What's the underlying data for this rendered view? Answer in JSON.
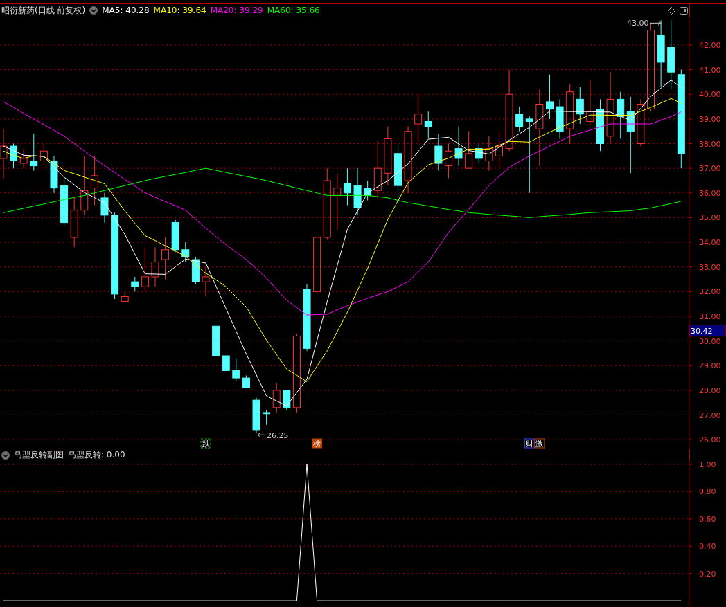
{
  "header": {
    "title": "昭衍新药(日线 前复权)",
    "ma": [
      {
        "label": "MA5: 40.28",
        "color": "#ffffff"
      },
      {
        "label": "MA10: 39.64",
        "color": "#ffff00"
      },
      {
        "label": "MA20: 39.29",
        "color": "#ff00ff"
      },
      {
        "label": "MA60: 35.66",
        "color": "#00ff00"
      }
    ]
  },
  "price_chart": {
    "chart_data": {
      "type": "candlestick",
      "grid": true,
      "ylim": [
        25.64,
        43.15
      ],
      "ohlc": [
        [
          37.4,
          38.6,
          36.6,
          37.9
        ],
        [
          37.9,
          38,
          37,
          37.3
        ],
        [
          37.2,
          37.8,
          37,
          37.4
        ],
        [
          37.3,
          38.4,
          36.9,
          37.1
        ],
        [
          37.3,
          38,
          37.1,
          37.7
        ],
        [
          37.3,
          37.5,
          36,
          36.2
        ],
        [
          36.3,
          36.6,
          34.7,
          34.8
        ],
        [
          34.2,
          35.8,
          33.8,
          35.3
        ],
        [
          35.3,
          37.5,
          35.1,
          36.1
        ],
        [
          36.2,
          37.5,
          35.5,
          36.7
        ],
        [
          35.8,
          36,
          34.8,
          35.1
        ],
        [
          35.1,
          35.2,
          31.7,
          31.9
        ],
        [
          31.6,
          32,
          31.6,
          31.8
        ],
        [
          32.4,
          32.6,
          32,
          32.2
        ],
        [
          32.2,
          33.8,
          32,
          32.6
        ],
        [
          32.6,
          33.8,
          32.2,
          33.2
        ],
        [
          33.3,
          34.2,
          32.5,
          33.7
        ],
        [
          34.8,
          34.9,
          33.6,
          33.7
        ],
        [
          33.7,
          34,
          33.2,
          33.4
        ],
        [
          33.3,
          33.4,
          32.3,
          32.4
        ],
        [
          32.4,
          33,
          31.8,
          32.6
        ],
        [
          30.6,
          30.6,
          29.4,
          29.4
        ],
        [
          29.4,
          29.4,
          28.8,
          28.8
        ],
        [
          28.8,
          29.3,
          28.4,
          28.5
        ],
        [
          28.5,
          28.6,
          28.1,
          28.1
        ],
        [
          27.6,
          27.7,
          26.25,
          26.4
        ],
        [
          27.1,
          27.2,
          26.6,
          27.05
        ],
        [
          27.3,
          28.3,
          27.1,
          28
        ],
        [
          28,
          28,
          27.2,
          27.3
        ],
        [
          27.3,
          30.3,
          27.1,
          30.2
        ],
        [
          32.1,
          32.3,
          29.6,
          29.7
        ],
        [
          32,
          34.2,
          31.9,
          34.2
        ],
        [
          34.2,
          37,
          34.1,
          36.5
        ],
        [
          35.9,
          36.8,
          34.5,
          36.2
        ],
        [
          36.4,
          37,
          35.5,
          36
        ],
        [
          36.3,
          37,
          35.1,
          35.4
        ],
        [
          36.2,
          36.5,
          35.7,
          35.9
        ],
        [
          36.1,
          38.1,
          35.8,
          37
        ],
        [
          36.8,
          38.7,
          36.3,
          38.2
        ],
        [
          37.6,
          38,
          35.6,
          36.3
        ],
        [
          36.5,
          38.7,
          36,
          38.5
        ],
        [
          38.8,
          40,
          38,
          39.2
        ],
        [
          38.9,
          39.3,
          38.2,
          38.7
        ],
        [
          37.9,
          38.4,
          36.9,
          37.2
        ],
        [
          37.1,
          38,
          36.6,
          37.7
        ],
        [
          37.8,
          38.7,
          37.1,
          37.4
        ],
        [
          37,
          38.5,
          37,
          37.6
        ],
        [
          37.8,
          38,
          37.2,
          37.4
        ],
        [
          37.3,
          38.3,
          36.9,
          37.8
        ],
        [
          37.5,
          38.5,
          37,
          37.9
        ],
        [
          37.8,
          41,
          37.7,
          40
        ],
        [
          39.2,
          39.5,
          38.5,
          38.7
        ],
        [
          39,
          39.1,
          36,
          38.9
        ],
        [
          38.6,
          40.2,
          37.1,
          39.6
        ],
        [
          39.7,
          40.8,
          39,
          39.4
        ],
        [
          39.5,
          39.8,
          38.2,
          38.5
        ],
        [
          38.6,
          40.4,
          38,
          40.1
        ],
        [
          39.8,
          40.3,
          38.8,
          39.2
        ],
        [
          38.9,
          40.6,
          38.8,
          39.3
        ],
        [
          39.4,
          39.8,
          37.7,
          38
        ],
        [
          38.3,
          40.9,
          38,
          39.8
        ],
        [
          39.8,
          40.1,
          38.2,
          39.1
        ],
        [
          39.3,
          39.9,
          36.8,
          38.5
        ],
        [
          38,
          39.8,
          37.9,
          39.6
        ],
        [
          39.4,
          42.9,
          39.3,
          42.6
        ],
        [
          42.4,
          43,
          40.3,
          41.3
        ],
        [
          41.9,
          43,
          40.2,
          40.9
        ],
        [
          40.8,
          41,
          37,
          37.6
        ]
      ],
      "categories": [
        null,
        null,
        null,
        null,
        null,
        null,
        null,
        null,
        null,
        null,
        null,
        null,
        null,
        null,
        null,
        null,
        null,
        null,
        null,
        null,
        null,
        null,
        null,
        null,
        null,
        null,
        null,
        null,
        null,
        null,
        null,
        null,
        null,
        null,
        null,
        null,
        null,
        null,
        null,
        null,
        null,
        null,
        null,
        null,
        null,
        null,
        null,
        null,
        null,
        null,
        null,
        null,
        null,
        null,
        null,
        null,
        null,
        null,
        null,
        null,
        null,
        null,
        null,
        null,
        null,
        null,
        null,
        null
      ],
      "yticks": [
        {
          "value": 42,
          "label": "42.00"
        },
        {
          "value": 41,
          "label": "41.00"
        },
        {
          "value": 40,
          "label": "40.00"
        },
        {
          "value": 39,
          "label": "39.00"
        },
        {
          "value": 38,
          "label": "38.00"
        },
        {
          "value": 37,
          "label": "37.00"
        },
        {
          "value": 36,
          "label": "36.00"
        },
        {
          "value": 35,
          "label": "35.00"
        },
        {
          "value": 34,
          "label": "34.00"
        },
        {
          "value": 33,
          "label": "33.00"
        },
        {
          "value": 32,
          "label": "32.00"
        },
        {
          "value": 31,
          "label": "31.00"
        },
        {
          "value": 30,
          "label": "30.00"
        },
        {
          "value": 29,
          "label": "29.00"
        },
        {
          "value": 28,
          "label": "28.00"
        },
        {
          "value": 27,
          "label": "27.00"
        },
        {
          "value": 26,
          "label": "26.00"
        }
      ],
      "series": [
        {
          "type": "line",
          "color": "#00ff00",
          "values": [
            35.2,
            35.29,
            35.38,
            35.47,
            35.55,
            35.64,
            35.73,
            35.82,
            35.9,
            36,
            36.1,
            36.2,
            36.3,
            36.4,
            36.5,
            36.59,
            36.67,
            36.75,
            36.83,
            36.92,
            37,
            36.92,
            36.83,
            36.75,
            36.67,
            36.59,
            36.5,
            36.4,
            36.3,
            36.2,
            36.1,
            36,
            35.9,
            35.9,
            35.9,
            35.9,
            35.9,
            35.85,
            35.8,
            35.7,
            35.6,
            35.54,
            35.47,
            35.4,
            35.33,
            35.27,
            35.2,
            35.17,
            35.13,
            35.1,
            35.07,
            35.04,
            35,
            35.04,
            35.07,
            35.1,
            35.13,
            35.17,
            35.2,
            35.22,
            35.24,
            35.26,
            35.28,
            35.34,
            35.39,
            35.48,
            35.57,
            35.66
          ]
        },
        {
          "type": "line",
          "color": "#ff00ff",
          "values": [
            39.7,
            39.47,
            39.23,
            39,
            38.77,
            38.54,
            38.3,
            38,
            37.7,
            37.4,
            37.1,
            36.83,
            36.55,
            36.28,
            36,
            35.83,
            35.65,
            35.48,
            35.3,
            34.94,
            34.57,
            34.24,
            33.9,
            33.6,
            33.3,
            32.93,
            32.55,
            32.1,
            31.65,
            31.35,
            31.05,
            31.07,
            31.08,
            31.26,
            31.43,
            31.58,
            31.73,
            31.87,
            32,
            32.2,
            32.4,
            32.8,
            33.2,
            33.8,
            34.4,
            34.87,
            35.33,
            35.82,
            36.3,
            36.67,
            37.03,
            37.27,
            37.5,
            37.7,
            37.9,
            38.1,
            38.3,
            38.43,
            38.55,
            38.68,
            38.8,
            38.8,
            38.8,
            38.8,
            38.8,
            38.95,
            39.1,
            39.29
          ]
        },
        {
          "type": "line",
          "color": "#ffff00",
          "values": [
            37.7,
            37.52,
            37.4,
            37.51,
            37.48,
            37.2,
            36.91,
            36.78,
            36.64,
            36.51,
            36.37,
            35.82,
            35.27,
            34.77,
            34.27,
            34.07,
            33.86,
            33.65,
            33.43,
            33.09,
            32.75,
            32.48,
            32.2,
            31.79,
            31.38,
            30.71,
            30.04,
            29.45,
            28.86,
            28.61,
            28.35,
            28.98,
            29.6,
            30.38,
            31.16,
            32.05,
            32.94,
            33.94,
            34.93,
            35.68,
            36.42,
            36.78,
            37.14,
            37.28,
            37.41,
            37.6,
            37.78,
            37.78,
            37.78,
            37.94,
            38.09,
            38.08,
            38.06,
            38.27,
            38.47,
            38.65,
            38.83,
            39,
            39.16,
            39.16,
            39.15,
            39.15,
            39.15,
            39.31,
            39.47,
            39.65,
            39.83,
            39.64
          ]
        },
        {
          "type": "line",
          "color": "#ffffff",
          "values": [
            37.9,
            37.72,
            37.53,
            37.51,
            37.48,
            37.06,
            36.64,
            36.33,
            36.02,
            35.81,
            35.6,
            34.96,
            34.32,
            33.52,
            32.72,
            32.71,
            32.7,
            33.01,
            33.32,
            33.24,
            33.16,
            32.24,
            31.32,
            30.4,
            29.48,
            28.63,
            27.77,
            27.57,
            27.37,
            27.91,
            28.45,
            30.02,
            31.58,
            33.05,
            34.52,
            35.26,
            36,
            36.25,
            36.5,
            36.84,
            37.18,
            37.68,
            38.18,
            38.22,
            38.26,
            37.99,
            37.72,
            37.65,
            37.58,
            37.86,
            38.14,
            38.4,
            38.66,
            38.99,
            39.32,
            39.31,
            39.3,
            39.3,
            39.3,
            39.29,
            39.28,
            39.11,
            38.94,
            39.43,
            39.92,
            40.25,
            40.58,
            40.28
          ]
        }
      ]
    },
    "current": "30.42"
  },
  "annotations": {
    "high": "43.00",
    "low": "26.25"
  },
  "events": [
    {
      "text": "跌",
      "kind": "fall"
    },
    {
      "text": "榜",
      "kind": "list"
    },
    {
      "text": "财",
      "kind": "finance"
    },
    {
      "text": "激",
      "kind": "surge"
    }
  ],
  "indicator": {
    "title": "岛型反转副图",
    "reading": "岛型反转: 0.00",
    "chart_data": {
      "type": "line",
      "grid": true,
      "ylim": [
        -0.035,
        1.025
      ],
      "categories": [
        null,
        null,
        null,
        null,
        null,
        null,
        null,
        null,
        null,
        null,
        null,
        null,
        null,
        null,
        null,
        null,
        null,
        null,
        null,
        null,
        null,
        null,
        null,
        null,
        null,
        null,
        null,
        null,
        null,
        null,
        null,
        null,
        null,
        null,
        null,
        null,
        null,
        null,
        null,
        null,
        null,
        null,
        null,
        null,
        null,
        null,
        null,
        null,
        null,
        null,
        null,
        null,
        null,
        null,
        null,
        null,
        null,
        null,
        null,
        null,
        null,
        null,
        null,
        null,
        null,
        null,
        null,
        null
      ],
      "yticks": [
        {
          "value": 1,
          "label": "1.00"
        },
        {
          "value": 0.8,
          "label": "0.80"
        },
        {
          "value": 0.6,
          "label": "0.60"
        },
        {
          "value": 0.4,
          "label": "0.40"
        },
        {
          "value": 0.2,
          "label": "0.20"
        }
      ],
      "series": [
        {
          "color": "#ffffff",
          "values": [
            0,
            0,
            0,
            0,
            0,
            0,
            0,
            0,
            0,
            0,
            0,
            0,
            0,
            0,
            0,
            0,
            0,
            0,
            0,
            0,
            0,
            0,
            0,
            0,
            0,
            0,
            0,
            0,
            0,
            0,
            1,
            0,
            0,
            0,
            0,
            0,
            0,
            0,
            0,
            0,
            0,
            0,
            0,
            0,
            0,
            0,
            0,
            0,
            0,
            0,
            0,
            0,
            0,
            0,
            0,
            0,
            0,
            0,
            0,
            0,
            0,
            0,
            0,
            0,
            0,
            0,
            0,
            0
          ]
        }
      ]
    }
  }
}
